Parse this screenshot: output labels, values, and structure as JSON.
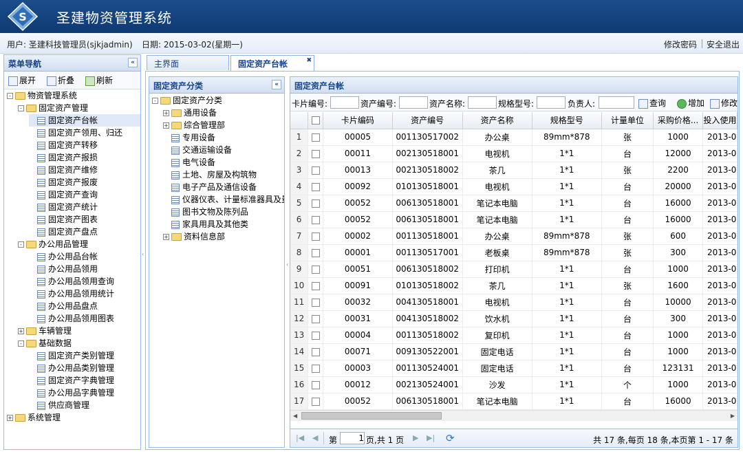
{
  "header": {
    "title": "圣建物资管理系统"
  },
  "infobar": {
    "user": "用户: 圣建科技管理员(sjkjadmin)",
    "date": "日期: 2015-03-02(星期一)",
    "change_pwd": "修改密码",
    "logout": "安全退出"
  },
  "menu": {
    "title": "菜单导航",
    "expand": "展开",
    "collapse": "折叠",
    "refresh": "刷新",
    "items": [
      "物资管理系统",
      "固定资产管理",
      "固定资产台帐",
      "固定资产领用、归还",
      "固定资产转移",
      "固定资产报损",
      "固定资产维修",
      "固定资产报废",
      "固定资产查询",
      "固定资产统计",
      "固定资产图表",
      "固定资产盘点",
      "办公用品管理",
      "办公用品台帐",
      "办公用品领用",
      "办公用品领用查询",
      "办公用品领用统计",
      "办公用品盘点",
      "办公用品领用图表",
      "车辆管理",
      "基础数据",
      "固定资产类别管理",
      "办公用品类别管理",
      "固定资产字典管理",
      "办公用品字典管理",
      "供应商管理",
      "系统管理"
    ]
  },
  "tabs": [
    "主界面",
    "固定资产台帐"
  ],
  "category": {
    "title": "固定资产分类",
    "items": [
      "固定资产分类",
      "通用设备",
      "综合管理部",
      "专用设备",
      "交通运输设备",
      "电气设备",
      "土地、房屋及构筑物",
      "电子产品及通信设备",
      "仪器仪表、计量标准器具及量具",
      "图书文物及陈列品",
      "家具用具及其他类",
      "资料信息部"
    ]
  },
  "grid": {
    "title": "固定资产台帐",
    "filters": {
      "card_no": "卡片编号:",
      "asset_no": "资产编号:",
      "asset_name": "资产名称:",
      "spec": "规格型号:",
      "owner": "负责人:",
      "search": "查询",
      "add": "增加",
      "edit": "修改"
    },
    "columns": [
      "卡片编码",
      "资产编号",
      "资产名称",
      "规格型号",
      "计量单位",
      "采购价格...",
      "投入使用"
    ],
    "rows": [
      [
        "1",
        "00005",
        "001130517002",
        "办公桌",
        "89mm*878",
        "张",
        "1000",
        "2013-0"
      ],
      [
        "2",
        "00011",
        "002130518001",
        "电视机",
        "1*1",
        "台",
        "12000",
        "2013-0"
      ],
      [
        "3",
        "00013",
        "002130518002",
        "茶几",
        "1*1",
        "张",
        "2200",
        "2013-0"
      ],
      [
        "4",
        "00092",
        "010130518001",
        "电视机",
        "1*1",
        "台",
        "20000",
        "2013-0"
      ],
      [
        "5",
        "00052",
        "006130518001",
        "笔记本电脑",
        "1*1",
        "台",
        "16000",
        "2013-0"
      ],
      [
        "6",
        "00052",
        "006130518001",
        "笔记本电脑",
        "1*1",
        "台",
        "16000",
        "2013-0"
      ],
      [
        "7",
        "00002",
        "001130518001",
        "办公桌",
        "89mm*878",
        "张",
        "600",
        "2013-0"
      ],
      [
        "8",
        "00001",
        "001130517001",
        "老板桌",
        "89mm*878",
        "张",
        "300",
        "2013-0"
      ],
      [
        "9",
        "00051",
        "006130518002",
        "打印机",
        "1*1",
        "台",
        "1000",
        "2013-0"
      ],
      [
        "10",
        "00091",
        "010130518002",
        "茶几",
        "1*1",
        "张",
        "1600",
        "2013-0"
      ],
      [
        "11",
        "00032",
        "004130518001",
        "电视机",
        "1*1",
        "台",
        "10000",
        "2013-0"
      ],
      [
        "12",
        "00031",
        "004130518002",
        "饮水机",
        "1*1",
        "台",
        "300",
        "2013-0"
      ],
      [
        "13",
        "00004",
        "001130518002",
        "复印机",
        "1*1",
        "台",
        "1000",
        "2013-0"
      ],
      [
        "14",
        "00071",
        "009130522001",
        "固定电话",
        "1*1",
        "台",
        "1000",
        "2013-0"
      ],
      [
        "15",
        "00003",
        "001130524001",
        "固定电话",
        "1*1",
        "台",
        "123131",
        "2013-0"
      ],
      [
        "16",
        "00012",
        "002130524001",
        "沙发",
        "1*1",
        "个",
        "1000",
        "2013-0"
      ],
      [
        "17",
        "00052",
        "006130518001",
        "笔记本电脑",
        "1*1",
        "台",
        "16000",
        "2013-0"
      ]
    ]
  },
  "pager": {
    "page_label": "第",
    "page_value": "1",
    "page_total": "页,共 1 页",
    "summary": "共 17 条,每页 18 条,本页第 1 - 17 条"
  }
}
